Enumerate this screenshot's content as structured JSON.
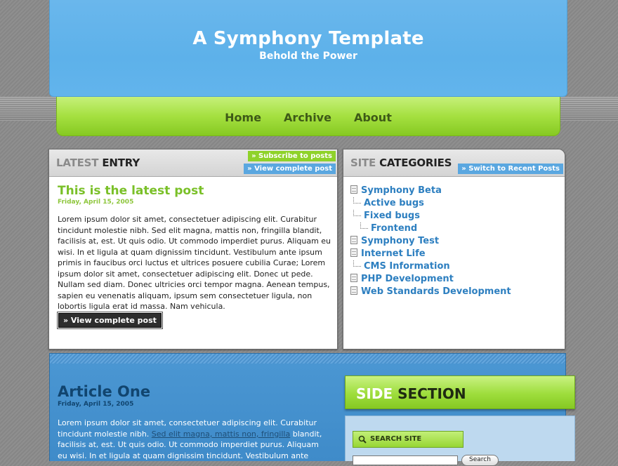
{
  "header": {
    "title": "A Symphony Template",
    "subtitle": "Behold the Power"
  },
  "nav": {
    "items": [
      "Home",
      "Archive",
      "About"
    ]
  },
  "latest_entry": {
    "heading_light": "LATEST",
    "heading_dark": "ENTRY",
    "subscribe_label": "» Subscribe to posts",
    "view_complete_top_label": "» View complete post",
    "post_title": "This is the latest post",
    "post_date": "Friday, April 15, 2005",
    "post_body": "Lorem ipsum dolor sit amet, consectetuer adipiscing elit. Curabitur tincidunt molestie nibh. Sed elit magna, mattis non, fringilla blandit, facilisis at, est. Ut quis odio. Ut commodo imperdiet purus. Aliquam eu wisi. In et ligula at quam dignissim tincidunt. Vestibulum ante ipsum primis in faucibus orci luctus et ultrices posuere cubilia Curae; Lorem ipsum dolor sit amet, consectetuer adipiscing elit. Donec ut pede. Nullam sed diam. Donec ultricies orci tempor magna. Aenean tempus, sapien eu venenatis aliquam, ipsum sem consectetuer ligula, non lobortis ligula erat id massa. Nam vehicula.",
    "view_complete_button": "» View complete post"
  },
  "site_categories": {
    "heading_light": "SITE",
    "heading_dark": "CATEGORIES",
    "switch_label": "» Switch to Recent Posts",
    "items": [
      {
        "label": "Symphony Beta",
        "level": 0
      },
      {
        "label": "Active bugs",
        "level": 1
      },
      {
        "label": "Fixed bugs",
        "level": 1
      },
      {
        "label": "Frontend",
        "level": 2
      },
      {
        "label": "Symphony Test",
        "level": 0
      },
      {
        "label": "Internet Life",
        "level": 0
      },
      {
        "label": "CMS Information",
        "level": 1
      },
      {
        "label": "PHP Development",
        "level": 0
      },
      {
        "label": "Web Standards Development",
        "level": 0
      }
    ]
  },
  "article": {
    "title": "Article One",
    "date": "Friday, April 15, 2005",
    "body_start": "Lorem ipsum dolor sit amet, consectetuer adipiscing elit. Curabitur tincidunt molestie nibh. ",
    "body_link": "Sed elit magna, mattis non, fringilla",
    "body_end": " blandit, facilisis at, est. Ut quis odio. Ut commodo imperdiet purus. Aliquam eu wisi. In et ligula at quam dignissim tincidunt. Vestibulum ante"
  },
  "side_section": {
    "heading_light": "SIDE",
    "heading_dark": "SECTION",
    "search_label": "SEARCH SITE",
    "search_button": "Search"
  },
  "colors": {
    "header_blue": "#5db1ea",
    "nav_green": "#a5e040",
    "accent_green": "#7ac028",
    "link_blue": "#2d7fc0",
    "article_blue": "#4a96d2"
  }
}
